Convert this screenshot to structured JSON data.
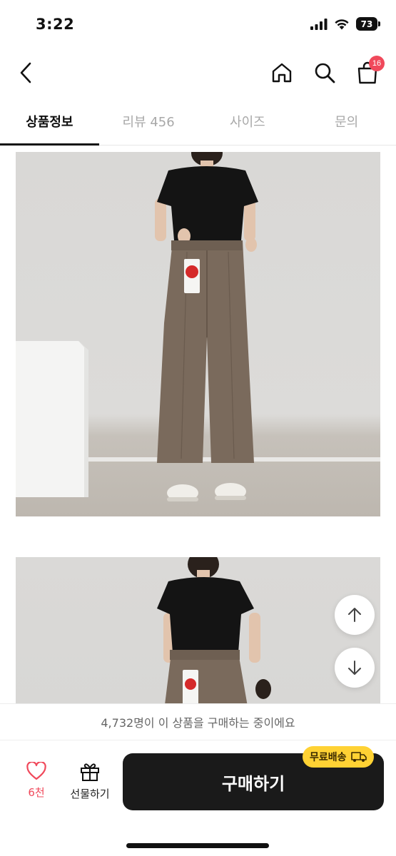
{
  "status_bar": {
    "time": "3:22",
    "battery_level": "73",
    "icons": [
      "cellular-signal-icon",
      "wifi-icon",
      "battery-icon"
    ]
  },
  "nav": {
    "icons": [
      "back-chevron-icon",
      "home-icon",
      "search-icon",
      "shopping-bag-icon"
    ],
    "cart_badge": "16"
  },
  "tabs": [
    {
      "label": "상품정보",
      "active": true
    },
    {
      "label": "리뷰 456",
      "active": false
    },
    {
      "label": "사이즈",
      "active": false
    },
    {
      "label": "문의",
      "active": false
    }
  ],
  "floating_buttons": [
    "arrow-up-icon",
    "arrow-down-icon"
  ],
  "buyer_notice": "4,732명이 이 상품을 구매하는 중이에요",
  "bottom_bar": {
    "like_count": "6천",
    "gift_label": "선물하기",
    "buy_label": "구매하기",
    "free_shipping_badge": "무료배송"
  },
  "colors": {
    "accent": "#f0495b",
    "buy_button": "#1a1a1a",
    "free_shipping": "#ffd234",
    "pants": "#7a6a5c",
    "shirt": "#141414"
  }
}
